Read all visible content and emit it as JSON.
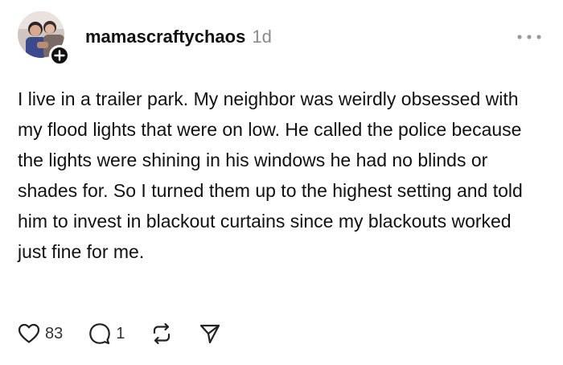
{
  "post": {
    "username": "mamascraftychaos",
    "timestamp": "1d",
    "body": "I live in a trailer park. My neighbor was weirdly obsessed with my flood lights that were on low. He called the police because the lights were shining in his windows he had no blinds or shades for. So I turned them up to the highest setting and told him to invest in blackout curtains since my blackouts worked just fine for me.",
    "avatar_icon": "profile-photo",
    "follow_icon": "plus-icon",
    "more_icon": "ellipsis-icon"
  },
  "actions": {
    "like": {
      "icon": "heart-icon",
      "count": "83"
    },
    "reply": {
      "icon": "speech-bubble-icon",
      "count": "1"
    },
    "repost": {
      "icon": "repost-icon"
    },
    "share": {
      "icon": "send-icon"
    }
  },
  "colors": {
    "text": "#111111",
    "muted": "#8a8a8a",
    "badge": "#111111"
  }
}
